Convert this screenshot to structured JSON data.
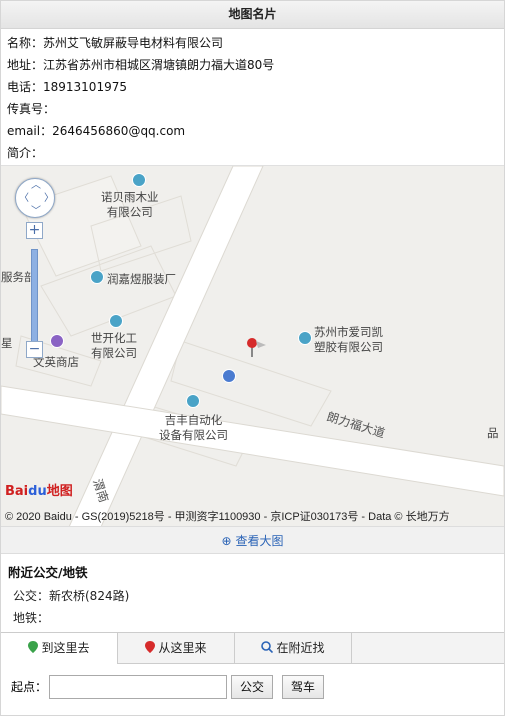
{
  "header": {
    "title": "地图名片"
  },
  "info": {
    "name": "名称：苏州艾飞敏屏蔽导电材料有限公司",
    "address": "地址：江苏省苏州市相城区渭塘镇朗力福大道80号",
    "phone": "电话：18913101975",
    "fax": "传真号：",
    "email": "email：2646456860@qq.com",
    "intro": "简介："
  },
  "map": {
    "pois": {
      "nuobei_1": "诺贝雨木业",
      "nuobei_2": "有限公司",
      "fuwubu": "服务部",
      "runjiayu": "润嘉煜服装厂",
      "shikai_1": "世开化工",
      "shikai_2": "有限公司",
      "aisikai_1": "苏州市爱司凯",
      "aisikai_2": "塑胶有限公司",
      "wenying": "文英商店",
      "xing": "星",
      "jifeng_1": "吉丰自动化",
      "jifeng_2": "设备有限公司",
      "pin": "品",
      "weinan": "渭南"
    },
    "road_label": "朗力福大道",
    "logo_text": "地图",
    "logo_brand": "Bai",
    "logo_paw": "du",
    "copyright": "© 2020 Baidu - GS(2019)5218号 - 甲测资字1100930 - 京ICP证030173号 - Data © 长地万方"
  },
  "view_large": "查看大图",
  "transit": {
    "title": "附近公交/地铁",
    "bus": "公交：新农桥(824路)",
    "subway": "地铁："
  },
  "tabs": [
    {
      "label": "到这里去"
    },
    {
      "label": "从这里来"
    },
    {
      "label": "在附近找"
    }
  ],
  "start": {
    "label": "起点：",
    "bus_button": "公交",
    "drive_button": "驾车"
  },
  "colors": {
    "link": "#2a63b6",
    "pin": "#d62b2b"
  }
}
